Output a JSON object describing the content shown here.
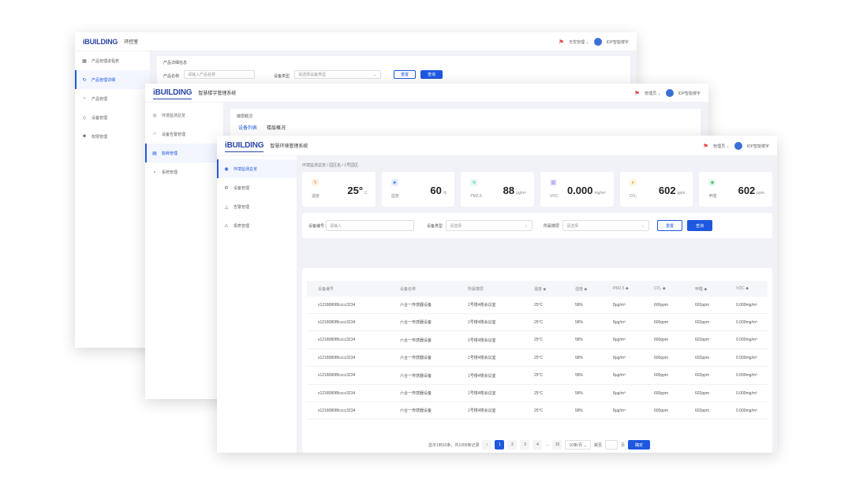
{
  "brand": {
    "logo": "iBUILDING",
    "logo_sub": "",
    "accent": "#1f58e0",
    "alert": "#e24b4b"
  },
  "window1": {
    "title": "环控室",
    "header_right": {
      "bell_icon": "bell-icon",
      "user": "无忧管理 ⌄",
      "project": "IDP智能楼宇"
    },
    "sidebar": [
      {
        "icon": "grid-icon",
        "label": "产品管理进程表"
      },
      {
        "icon": "link-icon",
        "label": "产品管理详细"
      },
      {
        "icon": "settings-icon",
        "label": "产品管理"
      },
      {
        "icon": "cube-icon",
        "label": "设备管理"
      },
      {
        "icon": "user-icon",
        "label": "权限管理"
      }
    ],
    "panel_title": "产品详细信息",
    "filter": {
      "label1": "产品名称",
      "input1": "请输入产品名称",
      "label2": "设备类型",
      "select2": "请选择设备类型",
      "btn_reset": "重置",
      "btn_query": "查询"
    }
  },
  "window2": {
    "title": "智慧楼宇管理系统",
    "header_right": {
      "user": "管理员 ⌄",
      "project": "IDP智能楼宇"
    },
    "sidebar": [
      {
        "icon": "gauge-icon",
        "label": "环境监测总览"
      },
      {
        "icon": "alert-icon",
        "label": "设备告警管理"
      },
      {
        "icon": "chart-icon",
        "label": "能耗管理"
      },
      {
        "icon": "dot-icon",
        "label": "系统管理"
      }
    ],
    "panel_title": "楼层概况",
    "tabs": [
      "设备列表",
      "楼层概况"
    ]
  },
  "window3": {
    "title": "智慧环境管理系统",
    "header_right": {
      "user": "管理员 ⌄",
      "project": "IDP智能楼宇"
    },
    "sidebar": [
      {
        "icon": "gauge-icon",
        "label": "环境监测总览"
      },
      {
        "icon": "gear-icon",
        "label": "设备管理"
      },
      {
        "icon": "alert-icon",
        "label": "告警管理"
      },
      {
        "icon": "warning-icon",
        "label": "报表管理"
      }
    ],
    "breadcrumb": "环境监测总览 / 园区名 / 1号园区",
    "cards": [
      {
        "icon": "thermometer-icon",
        "icon_color": "#f59a5a",
        "icon_bg": "#fff1e6",
        "label": "温度",
        "value": "25°",
        "unit": "C"
      },
      {
        "icon": "humidity-icon",
        "icon_color": "#3b7de8",
        "icon_bg": "#e8f0fd",
        "label": "湿度",
        "value": "60",
        "unit": "%"
      },
      {
        "icon": "pm25-icon",
        "icon_color": "#3cc7b4",
        "icon_bg": "#e6f8f5",
        "label": "PM2.5",
        "value": "88",
        "unit": "μg/m³"
      },
      {
        "icon": "voc-icon",
        "icon_color": "#9b6ee3",
        "icon_bg": "#f1ebfc",
        "label": "VOC",
        "value": "0.000",
        "unit": "mg/m³"
      },
      {
        "icon": "co2-icon",
        "icon_color": "#f2b43b",
        "icon_bg": "#fdf5e3",
        "label": "CO₂",
        "value": "602",
        "unit": "ppm"
      },
      {
        "icon": "formaldehyde-icon",
        "icon_color": "#4fc46e",
        "icon_bg": "#e9f8ed",
        "label": "甲醛",
        "value": "602",
        "unit": "ppm"
      }
    ],
    "filter": {
      "label1": "设备编号：",
      "input1_placeholder": "请输入",
      "label2": "设备类型",
      "select2": "请选择",
      "label3": "所属楼层",
      "select3": "请选择",
      "btn_reset": "重置",
      "btn_query": "查询"
    },
    "table": {
      "headers": [
        "设备编号",
        "设备名称",
        "所属楼层",
        "温度 ◆",
        "湿度 ◆",
        "PM2.5 ◆",
        "CO₂ ◆",
        "甲醛 ◆",
        "VOC ◆"
      ],
      "rows": [
        [
          "x1218080f8cccc3234",
          "六合一传感器设备",
          "1号楼4楼会议室",
          "25°C",
          "58%",
          "8μg/m³",
          "600ppm",
          "602ppm",
          "0.000mg/m³"
        ],
        [
          "x1218080f8cccc3234",
          "六合一传感器设备",
          "1号楼4楼会议室",
          "25°C",
          "58%",
          "8μg/m³",
          "600ppm",
          "602ppm",
          "0.000mg/m³"
        ],
        [
          "x1218080f8cccc3234",
          "六合一传感器设备",
          "1号楼4楼会议室",
          "25°C",
          "58%",
          "8μg/m³",
          "600ppm",
          "602ppm",
          "0.000mg/m³"
        ],
        [
          "x1218080f8cccc3234",
          "六合一传感器设备",
          "1号楼4楼会议室",
          "25°C",
          "58%",
          "8μg/m³",
          "600ppm",
          "602ppm",
          "0.000mg/m³"
        ],
        [
          "x1218080f8cccc3234",
          "六合一传感器设备",
          "1号楼4楼会议室",
          "25°C",
          "58%",
          "8μg/m³",
          "600ppm",
          "602ppm",
          "0.000mg/m³"
        ],
        [
          "x1218080f8cccc3234",
          "六合一传感器设备",
          "1号楼4楼会议室",
          "25°C",
          "58%",
          "8μg/m³",
          "600ppm",
          "602ppm",
          "0.000mg/m³"
        ],
        [
          "x1218080f8cccc3234",
          "六合一传感器设备",
          "1号楼4楼会议室",
          "25°C",
          "58%",
          "8μg/m³",
          "600ppm",
          "602ppm",
          "0.000mg/m³"
        ]
      ]
    },
    "pagination": {
      "summary": "显示1到10条，共1000条记录",
      "prev": "‹",
      "pages": [
        "1",
        "2",
        "3",
        "4",
        "…",
        "10"
      ],
      "active": "1",
      "page_size": "10条/页 ⌄",
      "goto_label": "跳至",
      "goto_unit": "页",
      "go_btn": "确定"
    }
  }
}
